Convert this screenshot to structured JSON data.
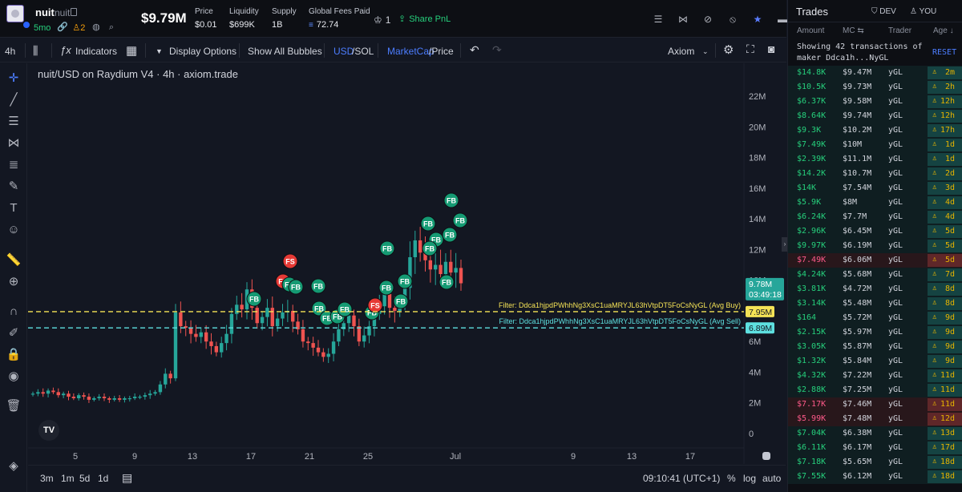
{
  "header": {
    "symbol": "nuit",
    "name": "nuit",
    "age": "5mo",
    "holders_count": "2",
    "price_big": "$9.79M",
    "stats": [
      {
        "label": "Price",
        "value": "$0.01"
      },
      {
        "label": "Liquidity",
        "value": "$699K"
      },
      {
        "label": "Supply",
        "value": "1B"
      },
      {
        "label": "Global Fees Paid",
        "value": "72.74"
      }
    ],
    "count": "1",
    "share_label": "Share PnL"
  },
  "toolbar": {
    "timeframe": "4h",
    "indicators": "Indicators",
    "display_options": "Display Options",
    "bubbles": "Show All Bubbles",
    "usd": "USD",
    "sol": "/SOL",
    "marketcap": "MarketCap",
    "price": "/Price",
    "source": "Axiom"
  },
  "chart": {
    "title": "nuit/USD on Raydium V4 · 4h · axiom.trade",
    "current_label": "9.78M",
    "countdown": "03:49:18",
    "buy_label": "7.95M",
    "sell_label": "6.89M",
    "buy_filter": "Filter: Ddca1hjpdPWhhNg3XsC1uaMRYJL63hVtpDT5FoCsNyGL (Avg Buy)",
    "sell_filter": "Filter: Ddca1hjpdPWhhNg3XsC1uaMRYJL63hVtpDT5FoCsNyGL (Avg Sell)"
  },
  "chart_data": {
    "type": "candlestick",
    "title": "nuit/USD on Raydium V4 · 4h · axiom.trade",
    "y_ticks": [
      "22M",
      "20M",
      "18M",
      "16M",
      "14M",
      "12M",
      "10M",
      "8M",
      "6M",
      "4M",
      "2M",
      "0"
    ],
    "x_ticks": [
      "5",
      "9",
      "13",
      "17",
      "21",
      "25",
      "Jul",
      "9",
      "13",
      "17"
    ],
    "ylim": [
      0,
      23
    ],
    "current_value_m": 9.78,
    "avg_buy_m": 7.95,
    "avg_sell_m": 6.89,
    "markers": [
      "FS",
      "FS",
      "FB",
      "FB",
      "FB",
      "FB",
      "FB",
      "FB",
      "FB",
      "FB",
      "FB",
      "FB",
      "FB",
      "FB",
      "FB",
      "FB",
      "FB",
      "FB",
      "FB",
      "FB",
      "FS",
      "FB",
      "FB"
    ],
    "series": [
      {
        "values": [
          2.6,
          2.7,
          2.6,
          2.8,
          2.7,
          2.5,
          2.6,
          2.4,
          2.3,
          2.5,
          2.4,
          2.2,
          2.3,
          2.4,
          2.3,
          2.2,
          2.3,
          2.2,
          2.3,
          2.3,
          2.4,
          2.4,
          2.5,
          2.6,
          2.7,
          3.2,
          3.9,
          3.6,
          7.9,
          7.0,
          6.9,
          6.5,
          6.3,
          6.6,
          6.0,
          5.7,
          5.3,
          5.9,
          6.5,
          7.8,
          8.4,
          8.1,
          9.4,
          8.2,
          7.2,
          7.6,
          8.2,
          7.0,
          7.5,
          7.9,
          8.0,
          7.3,
          6.8,
          6.0,
          5.9,
          5.6,
          5.3,
          5.0,
          5.2,
          6.0,
          6.8,
          7.2,
          7.7,
          7.0,
          6.0,
          6.4,
          7.0,
          7.8,
          8.3,
          9.1,
          8.2,
          8.0,
          8.6,
          9.5,
          11.5,
          12.6,
          11.8,
          11.3,
          10.7,
          11.0,
          10.4,
          11.2,
          10.5,
          10.8,
          9.8
        ]
      }
    ]
  },
  "bottom": {
    "ranges": [
      "3m",
      "1m",
      "5d",
      "1d"
    ],
    "clock": "09:10:41 (UTC+1)",
    "pct": "%",
    "log": "log",
    "auto": "auto"
  },
  "trades": {
    "title": "Trades",
    "filter_dev": "DEV",
    "filter_you": "YOU",
    "col_amount": "Amount",
    "col_mc": "MC",
    "col_trader": "Trader",
    "col_age": "Age",
    "message": "Showing 42 transactions of maker Ddca1h...NyGL",
    "reset": "RESET",
    "rows": [
      {
        "amount": "$14.8K",
        "mc": "$9.47M",
        "trader": "yGL",
        "age": "2m",
        "side": "buy"
      },
      {
        "amount": "$10.5K",
        "mc": "$9.73M",
        "trader": "yGL",
        "age": "2h",
        "side": "buy"
      },
      {
        "amount": "$6.37K",
        "mc": "$9.58M",
        "trader": "yGL",
        "age": "12h",
        "side": "buy"
      },
      {
        "amount": "$8.64K",
        "mc": "$9.74M",
        "trader": "yGL",
        "age": "12h",
        "side": "buy"
      },
      {
        "amount": "$9.3K",
        "mc": "$10.2M",
        "trader": "yGL",
        "age": "17h",
        "side": "buy"
      },
      {
        "amount": "$7.49K",
        "mc": "$10M",
        "trader": "yGL",
        "age": "1d",
        "side": "buy"
      },
      {
        "amount": "$2.39K",
        "mc": "$11.1M",
        "trader": "yGL",
        "age": "1d",
        "side": "buy"
      },
      {
        "amount": "$14.2K",
        "mc": "$10.7M",
        "trader": "yGL",
        "age": "2d",
        "side": "buy"
      },
      {
        "amount": "$14K",
        "mc": "$7.54M",
        "trader": "yGL",
        "age": "3d",
        "side": "buy"
      },
      {
        "amount": "$5.9K",
        "mc": "$8M",
        "trader": "yGL",
        "age": "4d",
        "side": "buy"
      },
      {
        "amount": "$6.24K",
        "mc": "$7.7M",
        "trader": "yGL",
        "age": "4d",
        "side": "buy"
      },
      {
        "amount": "$2.96K",
        "mc": "$6.45M",
        "trader": "yGL",
        "age": "5d",
        "side": "buy"
      },
      {
        "amount": "$9.97K",
        "mc": "$6.19M",
        "trader": "yGL",
        "age": "5d",
        "side": "buy"
      },
      {
        "amount": "$7.49K",
        "mc": "$6.06M",
        "trader": "yGL",
        "age": "5d",
        "side": "sell"
      },
      {
        "amount": "$4.24K",
        "mc": "$5.68M",
        "trader": "yGL",
        "age": "7d",
        "side": "buy"
      },
      {
        "amount": "$3.81K",
        "mc": "$4.72M",
        "trader": "yGL",
        "age": "8d",
        "side": "buy"
      },
      {
        "amount": "$3.14K",
        "mc": "$5.48M",
        "trader": "yGL",
        "age": "8d",
        "side": "buy"
      },
      {
        "amount": "$164",
        "mc": "$5.72M",
        "trader": "yGL",
        "age": "9d",
        "side": "buy"
      },
      {
        "amount": "$2.15K",
        "mc": "$5.97M",
        "trader": "yGL",
        "age": "9d",
        "side": "buy"
      },
      {
        "amount": "$3.05K",
        "mc": "$5.87M",
        "trader": "yGL",
        "age": "9d",
        "side": "buy"
      },
      {
        "amount": "$1.32K",
        "mc": "$5.84M",
        "trader": "yGL",
        "age": "9d",
        "side": "buy"
      },
      {
        "amount": "$4.32K",
        "mc": "$7.22M",
        "trader": "yGL",
        "age": "11d",
        "side": "buy"
      },
      {
        "amount": "$2.88K",
        "mc": "$7.25M",
        "trader": "yGL",
        "age": "11d",
        "side": "buy"
      },
      {
        "amount": "$7.17K",
        "mc": "$7.46M",
        "trader": "yGL",
        "age": "11d",
        "side": "sell"
      },
      {
        "amount": "$5.99K",
        "mc": "$7.48M",
        "trader": "yGL",
        "age": "12d",
        "side": "sell"
      },
      {
        "amount": "$7.04K",
        "mc": "$6.38M",
        "trader": "yGL",
        "age": "13d",
        "side": "buy"
      },
      {
        "amount": "$6.11K",
        "mc": "$6.17M",
        "trader": "yGL",
        "age": "17d",
        "side": "buy"
      },
      {
        "amount": "$7.18K",
        "mc": "$5.65M",
        "trader": "yGL",
        "age": "18d",
        "side": "buy"
      },
      {
        "amount": "$7.55K",
        "mc": "$6.12M",
        "trader": "yGL",
        "age": "18d",
        "side": "buy"
      }
    ]
  },
  "colors": {
    "buy": "#26a69a",
    "sell": "#ef5350",
    "buy_text": "#26d07c",
    "sell_text": "#ff5a8a",
    "buy_line": "#f5e356",
    "sell_line": "#5ee0e0",
    "accent": "#4c7dff"
  }
}
